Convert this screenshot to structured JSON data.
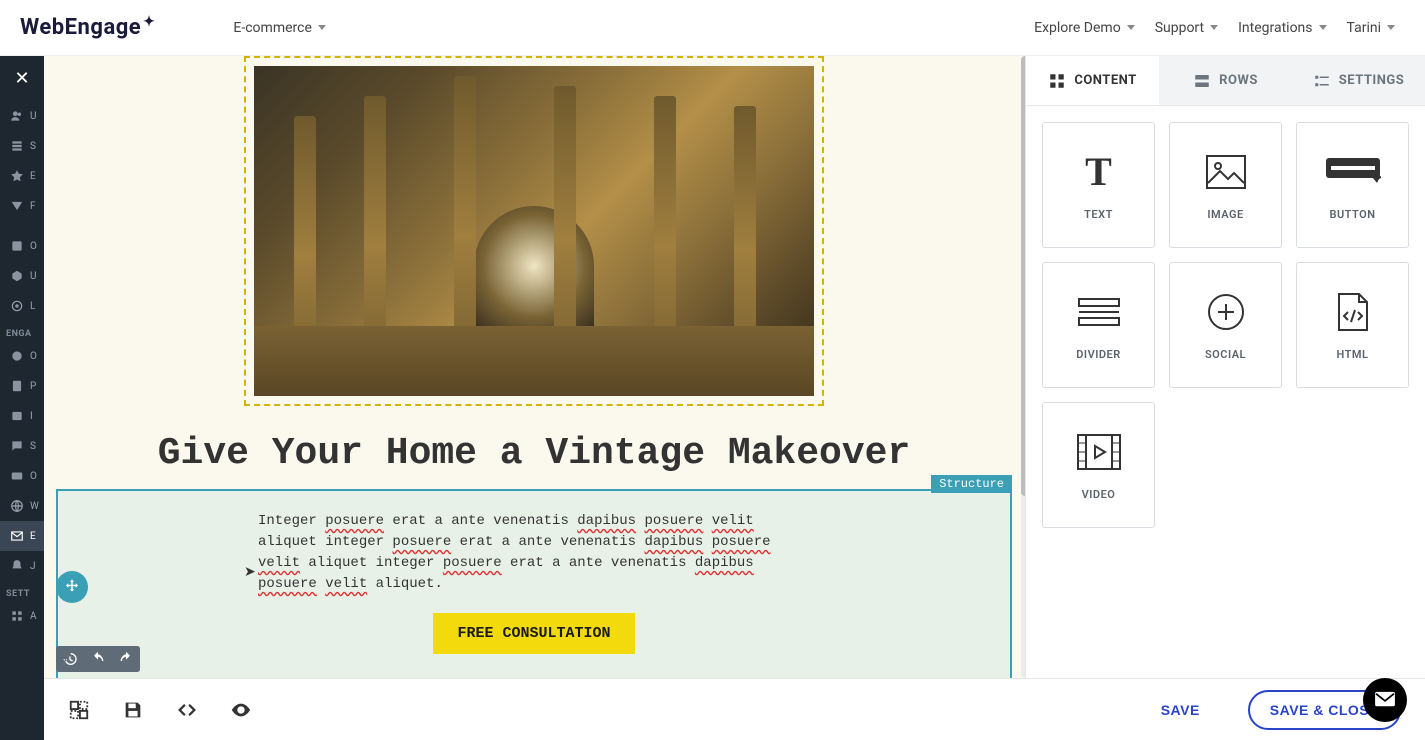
{
  "brand": "WebEngage",
  "top": {
    "project": "E-commerce",
    "links": [
      "Explore Demo",
      "Support",
      "Integrations",
      "Tarini"
    ]
  },
  "sidenav": {
    "close": "✕",
    "group1": [
      "U",
      "S",
      "E",
      "F"
    ],
    "group2": [
      "O",
      "U",
      "L"
    ],
    "engageHead": "ENGA",
    "group3": [
      "O",
      "P",
      "I",
      "S",
      "O",
      "W",
      "E",
      "J"
    ],
    "settHead": "SETT",
    "group4": [
      "A"
    ]
  },
  "email": {
    "heading": "Give Your Home a Vintage Makeover",
    "paragraph_parts": [
      {
        "t": "Integer ",
        "s": false
      },
      {
        "t": "posuere",
        "s": true
      },
      {
        "t": " erat a ante venenatis ",
        "s": false
      },
      {
        "t": "dapibus",
        "s": true
      },
      {
        "t": " ",
        "s": false
      },
      {
        "t": "posuere",
        "s": true
      },
      {
        "t": " ",
        "s": false
      },
      {
        "t": "velit",
        "s": true
      },
      {
        "t": " aliquet integer ",
        "s": false
      },
      {
        "t": "posuere",
        "s": true
      },
      {
        "t": " erat a ante venenatis ",
        "s": false
      },
      {
        "t": "dapibus",
        "s": true
      },
      {
        "t": " ",
        "s": false
      },
      {
        "t": "posuere",
        "s": true
      },
      {
        "t": " ",
        "s": false
      },
      {
        "t": "velit",
        "s": true
      },
      {
        "t": " aliquet integer ",
        "s": false
      },
      {
        "t": "posuere",
        "s": true
      },
      {
        "t": " erat a ante venenatis ",
        "s": false
      },
      {
        "t": "dapibus",
        "s": true
      },
      {
        "t": " ",
        "s": false
      },
      {
        "t": "posuere",
        "s": true
      },
      {
        "t": " ",
        "s": false
      },
      {
        "t": "velit",
        "s": true
      },
      {
        "t": " aliquet.",
        "s": false
      }
    ],
    "cta": "FREE CONSULTATION",
    "structure_tag": "Structure"
  },
  "panel": {
    "tabs": [
      "CONTENT",
      "ROWS",
      "SETTINGS"
    ],
    "tiles": [
      "TEXT",
      "IMAGE",
      "BUTTON",
      "DIVIDER",
      "SOCIAL",
      "HTML",
      "VIDEO"
    ]
  },
  "footer": {
    "save": "SAVE",
    "save_close": "SAVE & CLOSE"
  }
}
